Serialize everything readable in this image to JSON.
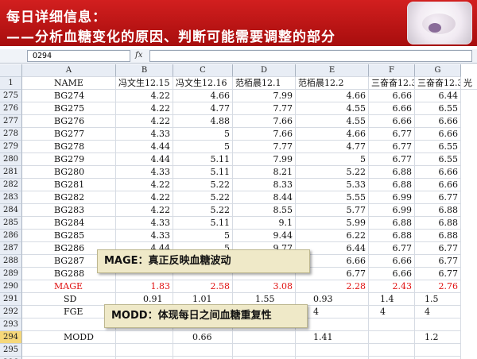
{
  "banner": {
    "title": "每日详细信息：",
    "subtitle": "——分析血糖变化的原因、判断可能需要调整的部分"
  },
  "formula_bar": {
    "name_box": "O294",
    "fx_label": "fx",
    "formula": ""
  },
  "columns": [
    "A",
    "B",
    "C",
    "D",
    "E",
    "F",
    "G"
  ],
  "name_row": {
    "row_num": "1",
    "cells": [
      "NAME",
      "冯文生12.15",
      "冯文生12.16",
      "范栢晨12.1",
      "范栢晨12.2",
      "三奋奋12.3",
      "三奋奋12.3",
      "光"
    ]
  },
  "data_rows": [
    {
      "row_num": "275",
      "name": "BG274",
      "b": "4.22",
      "c": "4.66",
      "d": "7.99",
      "e": "4.66",
      "f": "6.66",
      "g": "6.44"
    },
    {
      "row_num": "276",
      "name": "BG275",
      "b": "4.22",
      "c": "4.77",
      "d": "7.77",
      "e": "4.55",
      "f": "6.66",
      "g": "6.55"
    },
    {
      "row_num": "277",
      "name": "BG276",
      "b": "4.22",
      "c": "4.88",
      "d": "7.66",
      "e": "4.55",
      "f": "6.66",
      "g": "6.66"
    },
    {
      "row_num": "278",
      "name": "BG277",
      "b": "4.33",
      "c": "5",
      "d": "7.66",
      "e": "4.66",
      "f": "6.77",
      "g": "6.66"
    },
    {
      "row_num": "279",
      "name": "BG278",
      "b": "4.44",
      "c": "5",
      "d": "7.77",
      "e": "4.77",
      "f": "6.77",
      "g": "6.55"
    },
    {
      "row_num": "280",
      "name": "BG279",
      "b": "4.44",
      "c": "5.11",
      "d": "7.99",
      "e": "5",
      "f": "6.77",
      "g": "6.55"
    },
    {
      "row_num": "281",
      "name": "BG280",
      "b": "4.33",
      "c": "5.11",
      "d": "8.21",
      "e": "5.22",
      "f": "6.88",
      "g": "6.66"
    },
    {
      "row_num": "282",
      "name": "BG281",
      "b": "4.22",
      "c": "5.22",
      "d": "8.33",
      "e": "5.33",
      "f": "6.88",
      "g": "6.66"
    },
    {
      "row_num": "283",
      "name": "BG282",
      "b": "4.22",
      "c": "5.22",
      "d": "8.44",
      "e": "5.55",
      "f": "6.99",
      "g": "6.77"
    },
    {
      "row_num": "284",
      "name": "BG283",
      "b": "4.22",
      "c": "5.22",
      "d": "8.55",
      "e": "5.77",
      "f": "6.99",
      "g": "6.88"
    },
    {
      "row_num": "285",
      "name": "BG284",
      "b": "4.33",
      "c": "5.11",
      "d": "9.1",
      "e": "5.99",
      "f": "6.88",
      "g": "6.88"
    },
    {
      "row_num": "286",
      "name": "BG285",
      "b": "4.33",
      "c": "5",
      "d": "9.44",
      "e": "6.22",
      "f": "6.88",
      "g": "6.88"
    },
    {
      "row_num": "287",
      "name": "BG286",
      "b": "4.44",
      "c": "5",
      "d": "9.77",
      "e": "6.44",
      "f": "6.77",
      "g": "6.77"
    },
    {
      "row_num": "288",
      "name": "BG287",
      "b": "",
      "c": "",
      "d": "",
      "e": "6.66",
      "f": "6.66",
      "g": "6.77"
    },
    {
      "row_num": "289",
      "name": "BG288",
      "b": "",
      "c": "",
      "d": "",
      "e": "6.77",
      "f": "6.66",
      "g": "6.77"
    }
  ],
  "mage_row": {
    "row_num": "290",
    "name": "MAGE",
    "b": "1.83",
    "c": "2.58",
    "d": "3.08",
    "e": "2.28",
    "f": "2.43",
    "g": "2.76"
  },
  "sd_row": {
    "row_num": "291",
    "name": "SD",
    "b": "0.91",
    "c": "1.01",
    "d": "1.55",
    "e": "0.93",
    "f": "1.4",
    "g": "1.5"
  },
  "fge_row": {
    "row_num": "292",
    "name": "FGE",
    "b": "4",
    "c": "4",
    "d": "4",
    "e": "4",
    "f": "4",
    "g": "4"
  },
  "empty_row_293": {
    "row_num": "293"
  },
  "modd_row": {
    "row_num": "294",
    "name": "MODD",
    "b": "",
    "c": "0.66",
    "d": "",
    "e": "1.41",
    "f": "",
    "g": "1.2"
  },
  "empty_rows": [
    {
      "row_num": "295"
    },
    {
      "row_num": "296"
    }
  ],
  "callouts": {
    "mage": "MAGE：真正反映血糖波动",
    "modd": "MODD：体现每日之间血糖重复性"
  },
  "colors": {
    "banner_red": "#c41414",
    "mage_red": "#e01010",
    "callout_bg": "#efe9c8",
    "selected_row_header": "#f6d87a"
  }
}
